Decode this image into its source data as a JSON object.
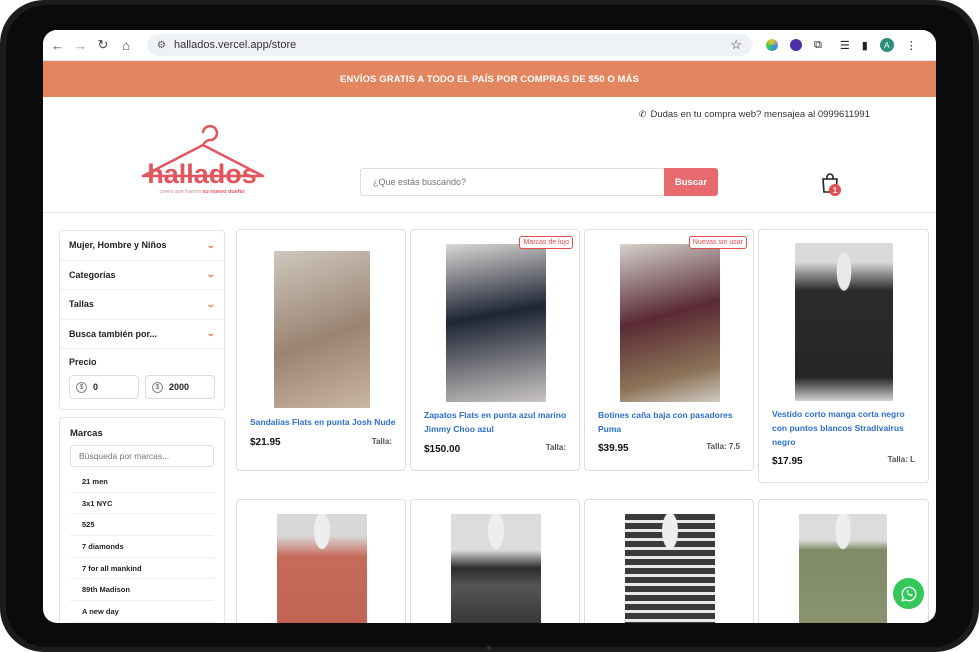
{
  "browser": {
    "url": "hallados.vercel.app/store",
    "profile_initial": "A"
  },
  "promo": {
    "text": "ENVÍOS GRATIS A TODO EL PAÍS POR COMPRAS DE $50 O MÁS"
  },
  "header": {
    "help_text": "Dudas en tu compra web? mensajea al 0999611991",
    "logo_text": "hallados",
    "logo_tagline_1": "crees que fueron ",
    "logo_tagline_2": "su nuevo dueño",
    "search_placeholder": "¿Que estás buscando?",
    "search_button": "Buscar",
    "cart_count": "1"
  },
  "filters": {
    "items": [
      {
        "label": "Mujer, Hombre y Niños"
      },
      {
        "label": "Categorías"
      },
      {
        "label": "Tallas"
      },
      {
        "label": "Busca también por..."
      }
    ],
    "price_label": "Precio",
    "price_min": "0",
    "price_max": "2000"
  },
  "brands": {
    "label": "Marcas",
    "search_placeholder": "Búsqueda por marcas...",
    "items": [
      "21 men",
      "3x1 NYC",
      "525",
      "7 diamonds",
      "7 for all mankind",
      "89th Madison",
      "A new day"
    ]
  },
  "products": [
    {
      "title_1": "Sandalias Flats en punta Josh Nude",
      "title_2": "",
      "title_3": "",
      "price": "$21.95",
      "size": "Talla:",
      "badge": "",
      "img": "#8b7a66"
    },
    {
      "title_1": "Zapatos Flats en punta azul marino",
      "title_2": "Jimmy Choo azul",
      "title_3": "",
      "price": "$150.00",
      "size": "Talla:",
      "badge": "Marcas de lujo",
      "img": "#1f2535"
    },
    {
      "title_1": "Botines caña baja con pasadores",
      "title_2": "Puma",
      "title_3": "",
      "price": "$39.95",
      "size": "Talla: 7.5",
      "badge": "Nuevas sin usar",
      "img": "#5a2a35"
    },
    {
      "title_1": "Vestido corto manga corta negro",
      "title_2": "con puntos blancos Stradivairus",
      "title_3": "negro",
      "price": "$17.95",
      "size": "Talla: L",
      "badge": "",
      "img": "#2b2b2b"
    },
    {
      "title_1": "",
      "price": "",
      "size": "",
      "badge": "",
      "img": "#c66a5a"
    },
    {
      "title_1": "",
      "price": "",
      "size": "",
      "badge": "",
      "img": "#2e2e2e"
    },
    {
      "title_1": "",
      "price": "",
      "size": "",
      "badge": "",
      "img": "#3a3a3a"
    },
    {
      "title_1": "",
      "price": "",
      "size": "",
      "badge": "",
      "img": "#7f8a66"
    }
  ],
  "colors": {
    "accent": "#e3855f",
    "button": "#e76a6e",
    "link": "#2c6fcf",
    "whatsapp": "#34c759"
  }
}
